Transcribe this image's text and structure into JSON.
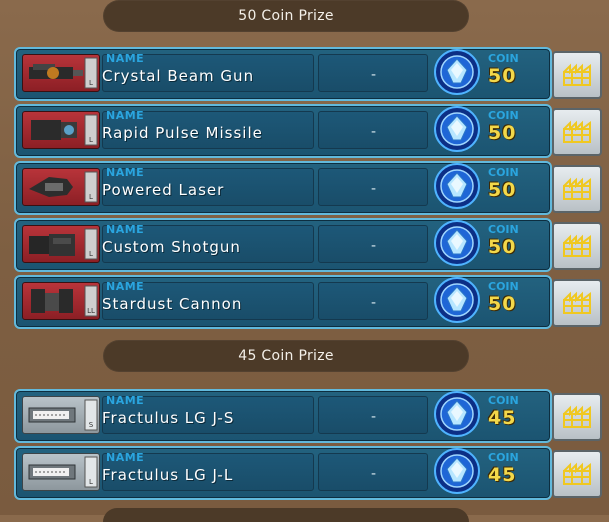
{
  "colors": {
    "background": "#7e5f42",
    "header_bg": "#4c3a28",
    "row_bg": "#23627f",
    "row_border": "#62b9dc",
    "label_blue": "#2aa5df",
    "coin_gold": "#f3d84a"
  },
  "sections": [
    {
      "title": "50 Coin Prize",
      "items": [
        {
          "name_label": "NAME",
          "name": "Crystal Beam Gun",
          "dash": "-",
          "coin_label": "COIN",
          "coin": "50",
          "icon": "beam-gun-icon",
          "size_tag": "L"
        },
        {
          "name_label": "NAME",
          "name": "Rapid Pulse Missile",
          "dash": "-",
          "coin_label": "COIN",
          "coin": "50",
          "icon": "missile-launcher-icon",
          "size_tag": "L"
        },
        {
          "name_label": "NAME",
          "name": "Powered Laser",
          "dash": "-",
          "coin_label": "COIN",
          "coin": "50",
          "icon": "laser-weapon-icon",
          "size_tag": "L"
        },
        {
          "name_label": "NAME",
          "name": "Custom Shotgun",
          "dash": "-",
          "coin_label": "COIN",
          "coin": "50",
          "icon": "shotgun-icon",
          "size_tag": "L"
        },
        {
          "name_label": "NAME",
          "name": "Stardust Cannon",
          "dash": "-",
          "coin_label": "COIN",
          "coin": "50",
          "icon": "cannon-icon",
          "size_tag": "LL"
        }
      ]
    },
    {
      "title": "45 Coin Prize",
      "items": [
        {
          "name_label": "NAME",
          "name": "Fractulus LG J-S",
          "dash": "-",
          "coin_label": "COIN",
          "coin": "45",
          "icon": "leg-part-icon",
          "size_tag": "S"
        },
        {
          "name_label": "NAME",
          "name": "Fractulus LG J-L",
          "dash": "-",
          "coin_label": "COIN",
          "coin": "45",
          "icon": "leg-part-icon",
          "size_tag": "L"
        }
      ]
    }
  ]
}
